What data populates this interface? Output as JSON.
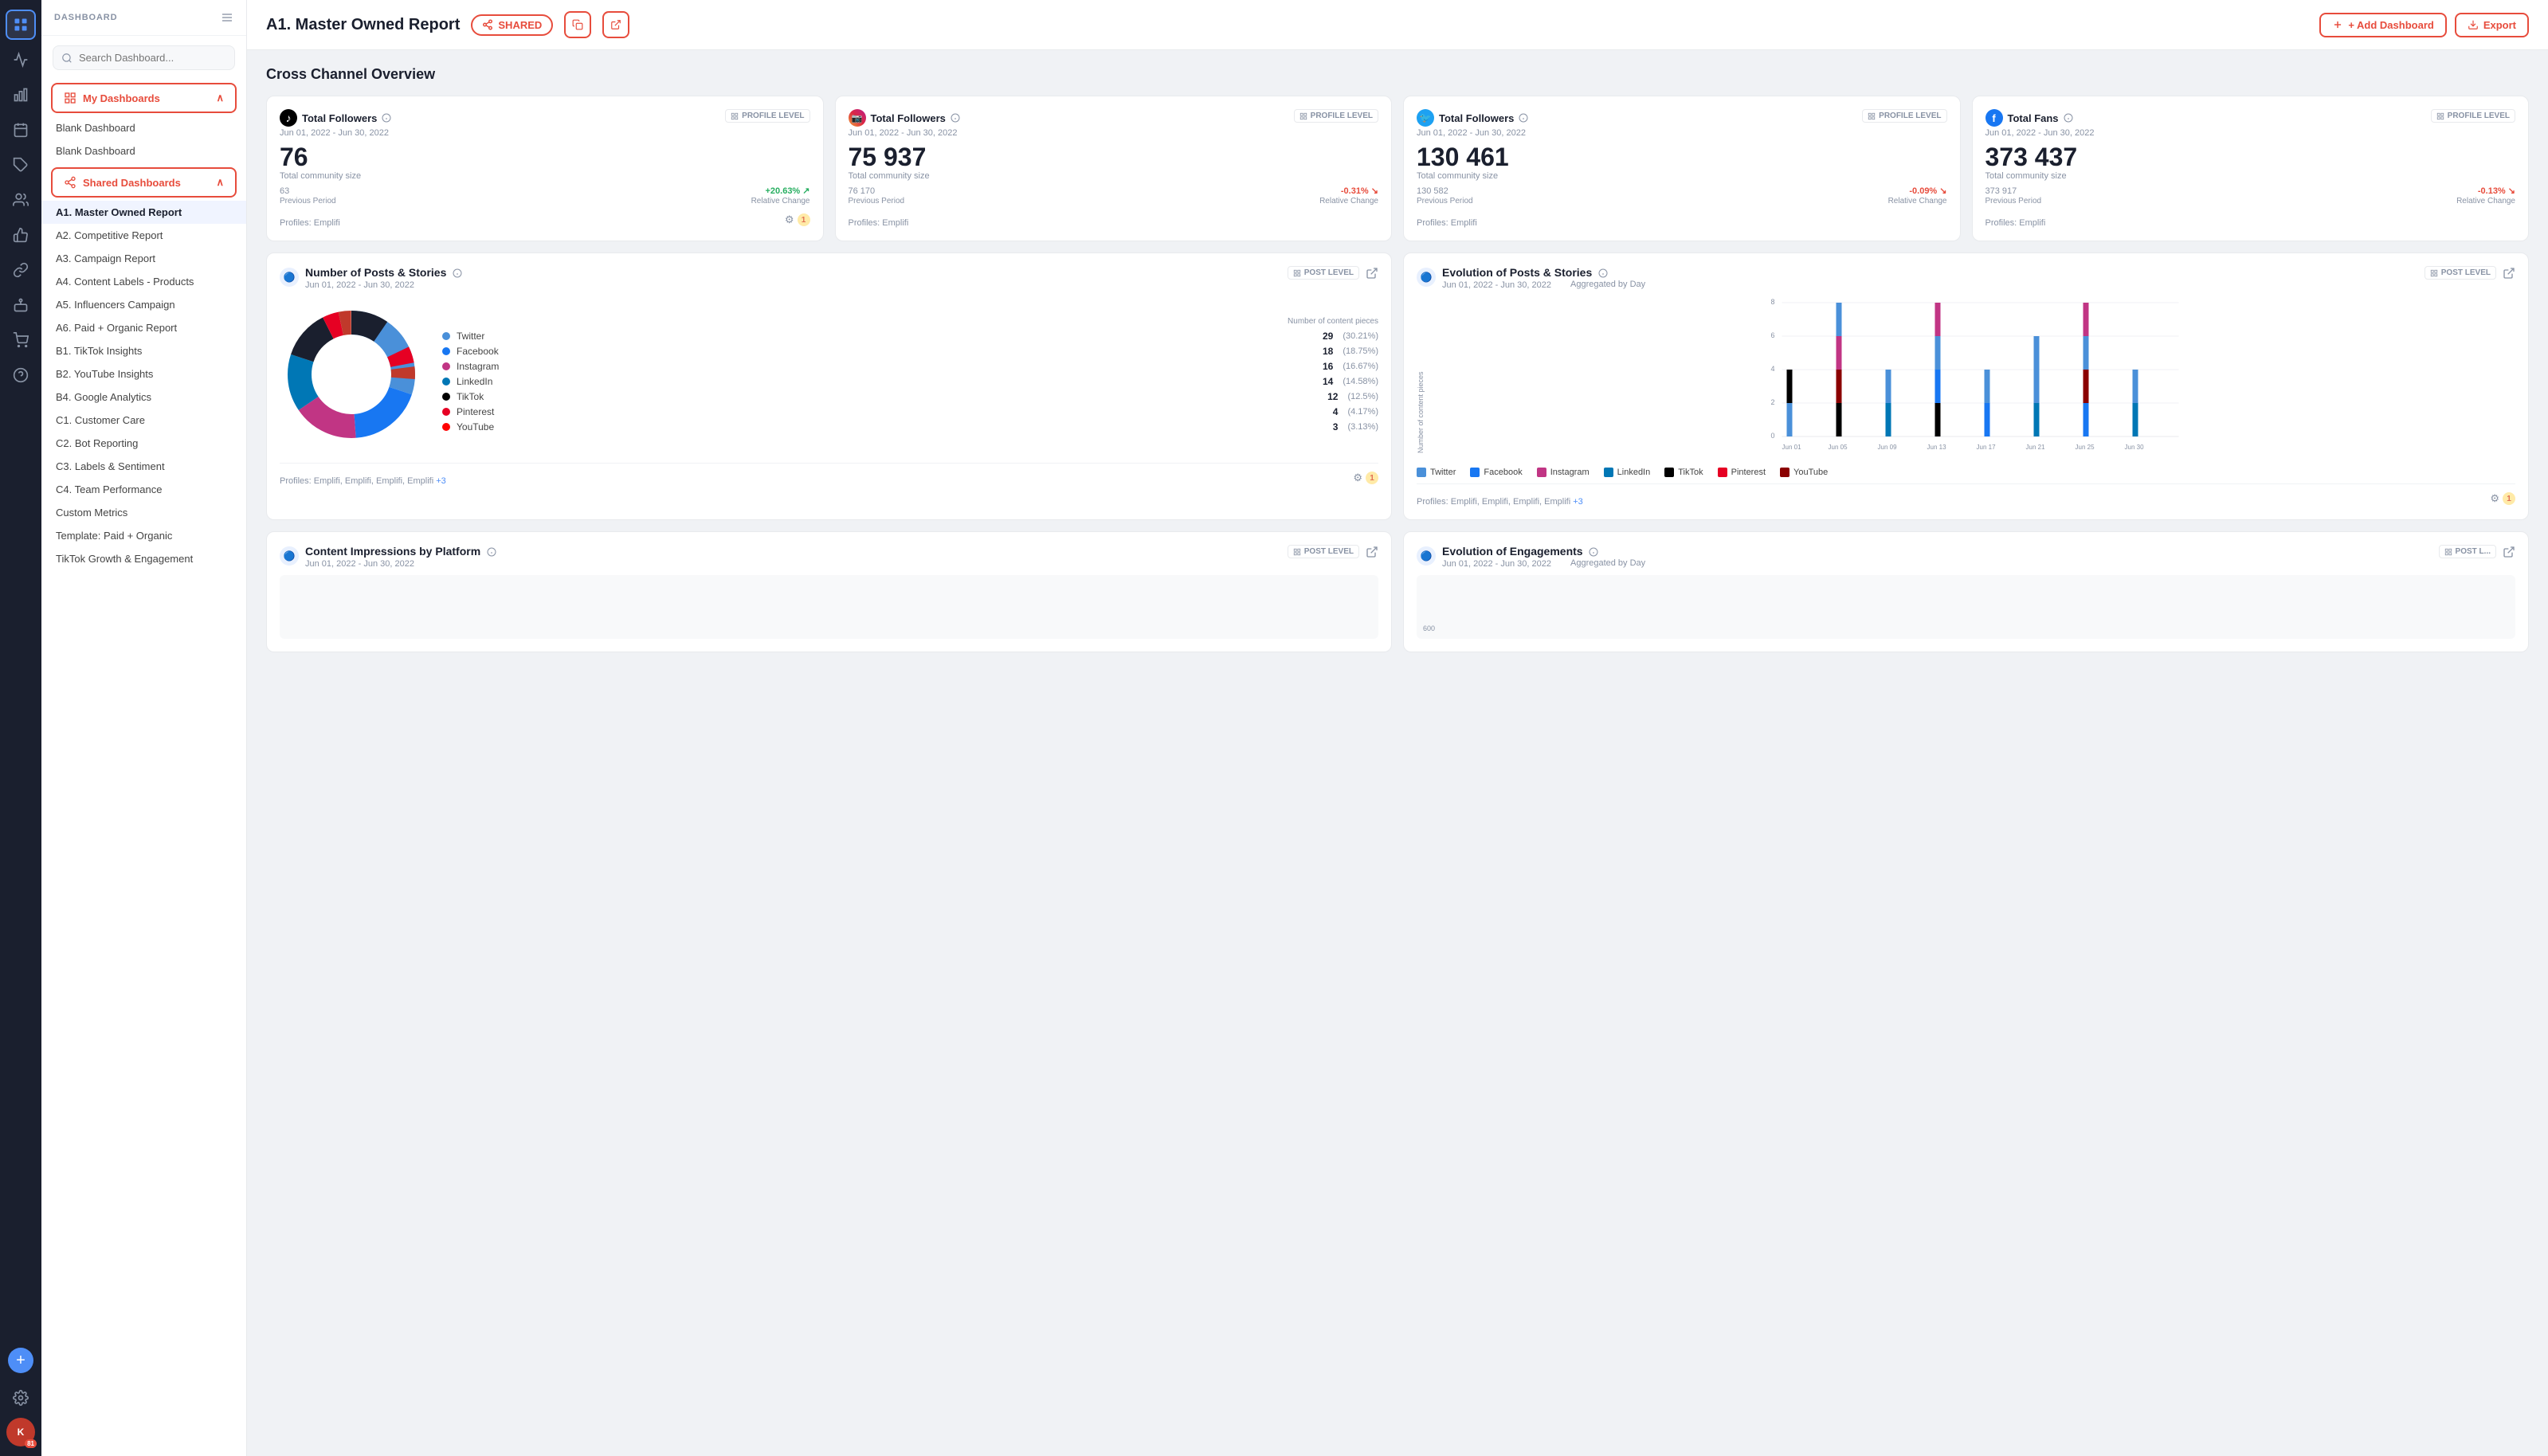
{
  "iconNav": {
    "icons": [
      {
        "name": "grid-icon",
        "symbol": "⊞",
        "active": true
      },
      {
        "name": "dashboard-icon",
        "symbol": "▦",
        "active": false
      },
      {
        "name": "bar-chart-icon",
        "symbol": "📊",
        "active": false
      },
      {
        "name": "calendar-icon",
        "symbol": "📅",
        "active": false
      },
      {
        "name": "tag-icon",
        "symbol": "🏷",
        "active": false
      },
      {
        "name": "users-icon",
        "symbol": "👥",
        "active": false
      },
      {
        "name": "thumbs-up-icon",
        "symbol": "👍",
        "active": false
      },
      {
        "name": "link-icon",
        "symbol": "🔗",
        "active": false
      },
      {
        "name": "bot-icon",
        "symbol": "🤖",
        "active": false
      },
      {
        "name": "cart-icon",
        "symbol": "🛒",
        "active": false
      },
      {
        "name": "help-icon",
        "symbol": "❓",
        "active": false
      }
    ],
    "bottomIcons": [
      {
        "name": "add-icon",
        "symbol": "+"
      },
      {
        "name": "settings-icon",
        "symbol": "⚙"
      }
    ],
    "avatar": {
      "initials": "K",
      "badge": "81"
    }
  },
  "sidebar": {
    "header": "DASHBOARD",
    "searchPlaceholder": "Search Dashboard...",
    "myDashboardsLabel": "My Dashboards",
    "myDashboardItems": [
      {
        "label": "Blank Dashboard"
      },
      {
        "label": "Blank Dashboard"
      }
    ],
    "sharedDashboardsLabel": "Shared Dashboards",
    "sharedDashboardItems": [
      {
        "label": "A1. Master Owned Report",
        "active": true
      },
      {
        "label": "A2. Competitive Report"
      },
      {
        "label": "A3. Campaign Report"
      },
      {
        "label": "A4. Content Labels - Products"
      },
      {
        "label": "A5. Influencers Campaign"
      },
      {
        "label": "A6. Paid + Organic Report"
      },
      {
        "label": "B1. TikTok Insights"
      },
      {
        "label": "B2. YouTube Insights"
      },
      {
        "label": "B4. Google Analytics"
      },
      {
        "label": "C1. Customer Care"
      },
      {
        "label": "C2. Bot Reporting"
      },
      {
        "label": "C3. Labels & Sentiment"
      },
      {
        "label": "C4. Team Performance"
      },
      {
        "label": "Custom Metrics"
      },
      {
        "label": "Template: Paid + Organic"
      },
      {
        "label": "TikTok Growth & Engagement"
      }
    ]
  },
  "topBar": {
    "title": "A1. Master Owned Report",
    "sharedLabel": "SHARED",
    "addDashboardLabel": "+ Add Dashboard",
    "exportLabel": "Export"
  },
  "main": {
    "sectionTitle": "Cross Channel Overview",
    "metrics": [
      {
        "platform": "tiktok",
        "platformSymbol": "♪",
        "platformBg": "#000",
        "platformColor": "#fff",
        "title": "Total Followers",
        "date": "Jun 01, 2022 - Jun 30, 2022",
        "value": "76",
        "communityLabel": "Total community size",
        "prevPeriod": "63",
        "prevLabel": "Previous Period",
        "change": "+20.63%",
        "changeDir": "up",
        "changeLabel": "Relative Change",
        "profiles": "Profiles: Emplifi",
        "badgeNum": "1"
      },
      {
        "platform": "instagram",
        "platformSymbol": "📷",
        "platformBg": "#c13584",
        "platformColor": "#fff",
        "title": "Total Followers",
        "date": "Jun 01, 2022 - Jun 30, 2022",
        "value": "75 937",
        "communityLabel": "Total community size",
        "prevPeriod": "76 170",
        "prevLabel": "Previous Period",
        "change": "-0.31%",
        "changeDir": "down",
        "changeLabel": "Relative Change",
        "profiles": "Profiles: Emplifi"
      },
      {
        "platform": "twitter",
        "platformSymbol": "🐦",
        "platformBg": "#1da1f2",
        "platformColor": "#fff",
        "title": "Total Followers",
        "date": "Jun 01, 2022 - Jun 30, 2022",
        "value": "130 461",
        "communityLabel": "Total community size",
        "prevPeriod": "130 582",
        "prevLabel": "Previous Period",
        "change": "-0.09%",
        "changeDir": "down",
        "changeLabel": "Relative Change",
        "profiles": "Profiles: Emplifi"
      },
      {
        "platform": "facebook",
        "platformSymbol": "f",
        "platformBg": "#1877f2",
        "platformColor": "#fff",
        "title": "Total Fans",
        "date": "Jun 01, 2022 - Jun 30, 2022",
        "value": "373 437",
        "communityLabel": "Total community size",
        "prevPeriod": "373 917",
        "prevLabel": "Previous Period",
        "change": "-0.13%",
        "changeDir": "down",
        "changeLabel": "Relative Change",
        "profiles": "Profiles: Emplifi"
      }
    ],
    "charts": [
      {
        "id": "posts-donut",
        "platformSymbol": "🔵",
        "title": "Number of Posts & Stories",
        "date": "Jun 01, 2022 - Jun 30, 2022",
        "legendNumLabel": "Number of content pieces",
        "profilesLabel": "Profiles: Emplifi, Emplifi, Emplifi, Emplifi +3",
        "badgeNum": "1",
        "legend": [
          {
            "name": "Twitter",
            "color": "#4a90d9",
            "count": "29",
            "pct": "(30.21%)"
          },
          {
            "name": "Facebook",
            "color": "#1877f2",
            "count": "18",
            "pct": "(18.75%)"
          },
          {
            "name": "Instagram",
            "color": "#c13584",
            "count": "16",
            "pct": "(16.67%)"
          },
          {
            "name": "LinkedIn",
            "color": "#0077b5",
            "count": "14",
            "pct": "(14.58%)"
          },
          {
            "name": "TikTok",
            "color": "#000000",
            "count": "12",
            "pct": "(12.5%)"
          },
          {
            "name": "Pinterest",
            "color": "#e60023",
            "count": "4",
            "pct": "(4.17%)"
          },
          {
            "name": "YouTube",
            "color": "#ff0000",
            "count": "3",
            "pct": "(3.13%)"
          }
        ]
      },
      {
        "id": "posts-bar",
        "platformSymbol": "🔵",
        "title": "Evolution of Posts & Stories",
        "date": "Jun 01, 2022 - Jun 30, 2022",
        "aggregated": "Aggregated by Day",
        "profilesLabel": "Profiles: Emplifi, Emplifi, Emplifi, Emplifi +3",
        "badgeNum": "1",
        "yLabel": "Number of content pieces",
        "xLabels": [
          "Jun 01",
          "Jun 05",
          "Jun 09",
          "Jun 13",
          "Jun 17",
          "Jun 21",
          "Jun 25",
          "Jun 30"
        ],
        "legend": [
          {
            "name": "Twitter",
            "color": "#4a90d9"
          },
          {
            "name": "Facebook",
            "color": "#1877f2"
          },
          {
            "name": "Instagram",
            "color": "#c13584"
          },
          {
            "name": "LinkedIn",
            "color": "#0077b5"
          },
          {
            "name": "TikTok",
            "color": "#000000"
          },
          {
            "name": "Pinterest",
            "color": "#e60023"
          },
          {
            "name": "YouTube",
            "color": "#8b0000"
          }
        ]
      }
    ],
    "bottomCharts": [
      {
        "title": "Content Impressions by Platform",
        "date": "Jun 01, 2022 - Jun 30, 2022"
      },
      {
        "title": "Evolution of Engagements",
        "date": "Jun 01, 2022 - Jun 30, 2022",
        "aggregated": "Aggregated by Day",
        "yValue": "600"
      }
    ]
  }
}
